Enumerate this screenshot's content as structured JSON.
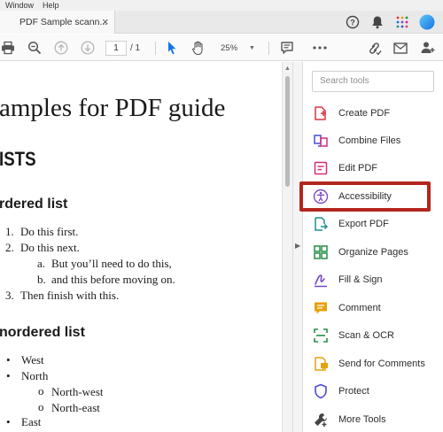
{
  "menubar": {
    "items": [
      "Window",
      "Help"
    ]
  },
  "tab": {
    "title": "PDF Sample scann...",
    "close": "×"
  },
  "toolbar": {
    "page_current": "1",
    "page_total": "/ 1",
    "zoom": "25%"
  },
  "document": {
    "title": "amples for PDF guide",
    "lists_heading": "ISTS",
    "ordered_heading": "rdered list",
    "ordered_items": [
      {
        "marker": "1.",
        "text": "Do this first."
      },
      {
        "marker": "2.",
        "text": "Do this next."
      },
      {
        "marker": "a.",
        "text": "But you’ll need to do this,"
      },
      {
        "marker": "b.",
        "text": "and this before moving on."
      },
      {
        "marker": "3.",
        "text": "Then finish with this."
      }
    ],
    "unordered_heading": "nordered list",
    "unordered_items": [
      {
        "marker": "•",
        "text": "West"
      },
      {
        "marker": "•",
        "text": "North"
      },
      {
        "marker": "o",
        "text": "North-west"
      },
      {
        "marker": "o",
        "text": "North-east"
      },
      {
        "marker": "•",
        "text": "East"
      }
    ]
  },
  "tools_pane": {
    "search_placeholder": "Search tools",
    "tools": [
      {
        "label": "Create PDF",
        "icon": "create-pdf-icon",
        "color": "#d7373f"
      },
      {
        "label": "Combine Files",
        "icon": "combine-files-icon",
        "color": "#4b4bd6"
      },
      {
        "label": "Edit PDF",
        "icon": "edit-pdf-icon",
        "color": "#d52b7a"
      },
      {
        "label": "Accessibility",
        "icon": "accessibility-icon",
        "color": "#7e47c7"
      },
      {
        "label": "Export PDF",
        "icon": "export-pdf-icon",
        "color": "#1e8f8f"
      },
      {
        "label": "Organize Pages",
        "icon": "organize-pages-icon",
        "color": "#268e45"
      },
      {
        "label": "Fill & Sign",
        "icon": "fill-sign-icon",
        "color": "#6c3fc4"
      },
      {
        "label": "Comment",
        "icon": "comment-icon",
        "color": "#e7a10b"
      },
      {
        "label": "Scan & OCR",
        "icon": "scan-ocr-icon",
        "color": "#268e45"
      },
      {
        "label": "Send for Comments",
        "icon": "send-for-comments-icon",
        "color": "#e7a10b"
      },
      {
        "label": "Protect",
        "icon": "protect-icon",
        "color": "#4b4bd6"
      },
      {
        "label": "More Tools",
        "icon": "more-tools-icon",
        "color": "#444444"
      }
    ]
  },
  "colors": {
    "highlight": "#b3261e",
    "accent_blue": "#1473e6"
  }
}
